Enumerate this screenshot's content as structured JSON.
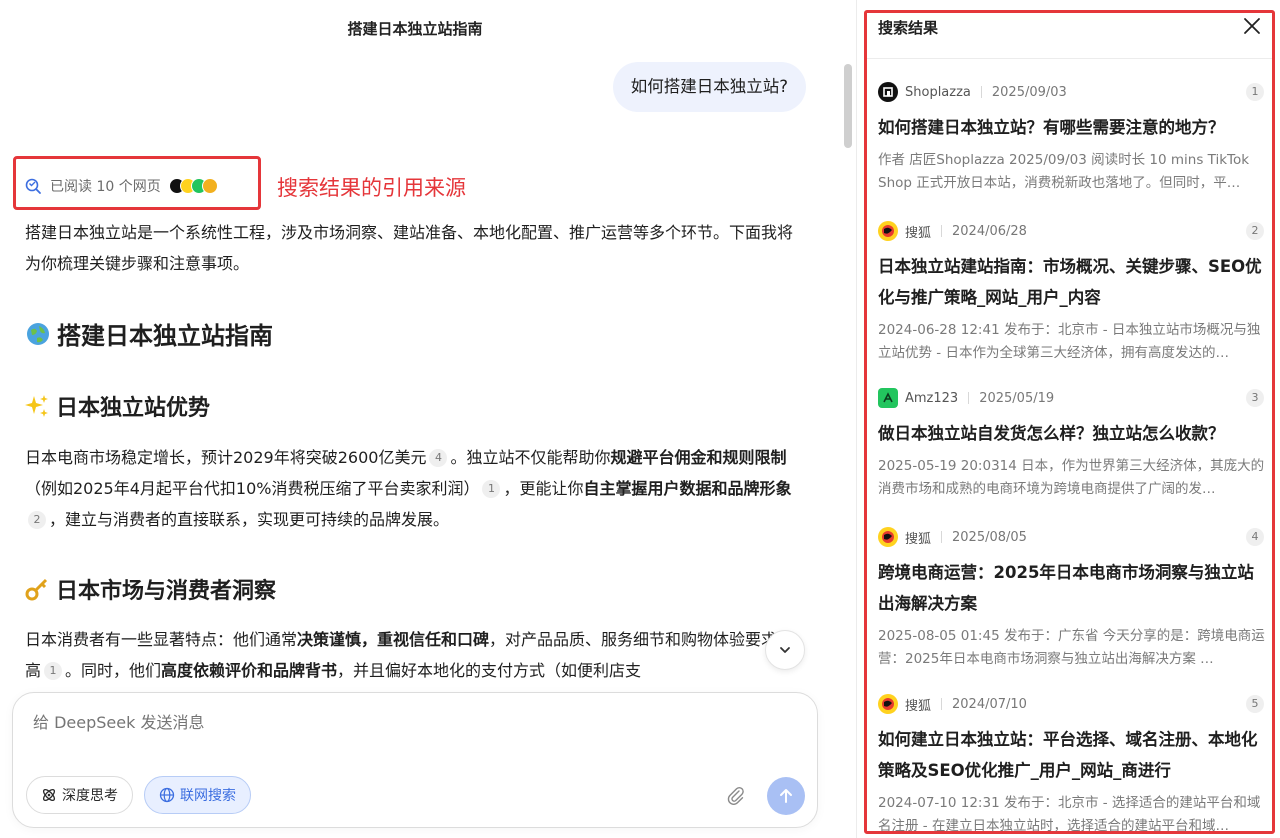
{
  "chat": {
    "title": "搭建日本独立站指南",
    "user_message": "如何搭建日本独立站?",
    "read_sources": "已阅读 10 个网页",
    "annotation": "搜索结果的引用来源",
    "intro": "搭建日本独立站是一个系统性工程，涉及市场洞察、建站准备、本地化配置、推广运营等多个环节。下面我将为你梳理关键步骤和注意事项。",
    "heading_main": "搭建日本独立站指南",
    "section1": {
      "heading": "日本独立站优势",
      "t1": "日本电商市场稳定增长，预计2029年将突破2600亿美元",
      "c1": "4",
      "t2": "。独立站不仅能帮助你",
      "b1": "规避平台佣金和规则限制",
      "t3": "（例如2025年4月起平台代扣10%消费税压缩了平台卖家利润）",
      "c2": "1",
      "t4": "，更能让你",
      "b2": "自主掌握用户数据和品牌形象",
      "c3": "2",
      "t5": "，建立与消费者的直接联系，实现更可持续的品牌发展。"
    },
    "section2": {
      "heading": "日本市场与消费者洞察",
      "t1": "日本消费者有一些显著特点：他们通常",
      "b1": "决策谨慎，重视信任和口碑",
      "t2": "，对产品品质、服务细节和购物体验要求很高",
      "c1": "1",
      "t3": "。同时，他们",
      "b2": "高度依赖评价和品牌背书",
      "t4": "，并且偏好本地化的支付方式（如便利店支"
    }
  },
  "composer": {
    "placeholder": "给 DeepSeek 发送消息",
    "deep_think_label": "深度思考",
    "web_search_label": "联网搜索"
  },
  "panel": {
    "title": "搜索结果",
    "results": [
      {
        "source": "Shoplazza",
        "date": "2025/09/03",
        "num": "1",
        "title": "如何搭建日本独立站？有哪些需要注意的地方？",
        "snippet": "作者 店匠Shoplazza 2025/09/03 阅读时长 10 mins TikTok Shop 正式开放日本站，消费税新政也落地了。但同时，平…",
        "favicon": "shoplazza-logo-icon",
        "color": "#111111"
      },
      {
        "source": "搜狐",
        "date": "2024/06/28",
        "num": "2",
        "title": "日本独立站建站指南：市场概况、关键步骤、SEO优化与推广策略_网站_用户_内容",
        "snippet": "2024-06-28 12:41 发布于：北京市 - 日本独立站市场概况与独立站优势 - 日本作为全球第三大经济体，拥有高度发达的…",
        "favicon": "sohu-logo-icon",
        "color": "#ffd21f"
      },
      {
        "source": "Amz123",
        "date": "2025/05/19",
        "num": "3",
        "title": "做日本独立站自发货怎么样？独立站怎么收款？",
        "snippet": "2025-05-19 20:0314 日本，作为世界第三大经济体，其庞大的消费市场和成熟的电商环境为跨境电商提供了广阔的发…",
        "favicon": "amz123-logo-icon",
        "color": "#22c55e"
      },
      {
        "source": "搜狐",
        "date": "2025/08/05",
        "num": "4",
        "title": "跨境电商运营：2025年日本电商市场洞察与独立站出海解决方案",
        "snippet": "2025-08-05 01:45 发布于：广东省 今天分享的是：跨境电商运营：2025年日本电商市场洞察与独立站出海解决方案 …",
        "favicon": "sohu-logo-icon",
        "color": "#ffd21f"
      },
      {
        "source": "搜狐",
        "date": "2024/07/10",
        "num": "5",
        "title": "如何建立日本独立站：平台选择、域名注册、本地化策略及SEO优化推广_用户_网站_商进行",
        "snippet": "2024-07-10 12:31 发布于：北京市 - 选择适合的建站平台和域名注册 - 在建立日本独立站时，选择适合的建站平台和域…",
        "favicon": "sohu-logo-icon",
        "color": "#ffd21f"
      }
    ]
  },
  "colors": {
    "accent": "#3c6ee0",
    "highlight_red": "#e5363a",
    "bubble": "#eef2fd"
  }
}
